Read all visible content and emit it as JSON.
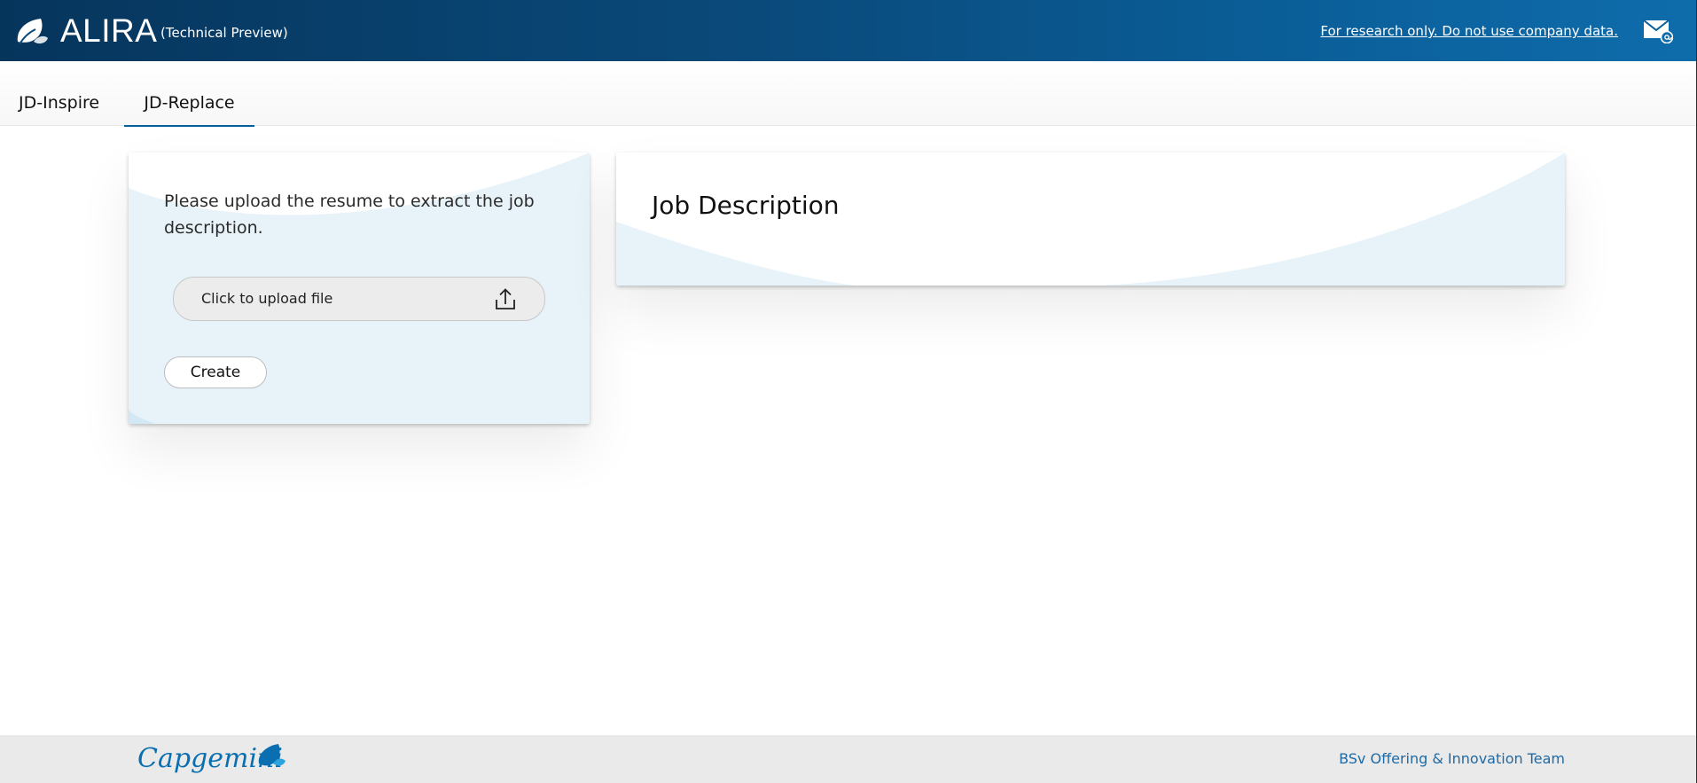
{
  "header": {
    "app_name": "ALIRA",
    "app_subtitle": "(Technical Preview)",
    "research_notice": "For research only. Do not use company data.",
    "logo_icon": "spade-leaf-icon",
    "mail_icon": "mail-at-icon"
  },
  "tabs": [
    {
      "label": "JD-Inspire",
      "active": false
    },
    {
      "label": "JD-Replace",
      "active": true
    }
  ],
  "upload_panel": {
    "instruction": "Please upload the resume to extract the job description.",
    "upload_label": "Click to upload file",
    "upload_icon": "upload-icon",
    "create_label": "Create"
  },
  "job_panel": {
    "title": "Job Description"
  },
  "footer": {
    "brand": "Capgemini",
    "team": "BSv Offering & Innovation Team"
  },
  "colors": {
    "header_start": "#06355c",
    "header_end": "#0f6cab",
    "accent": "#0a5e98",
    "card_wash": "#e7f2f9",
    "footer_bg": "#eaeaea",
    "brand_blue": "#0a6fb0"
  }
}
